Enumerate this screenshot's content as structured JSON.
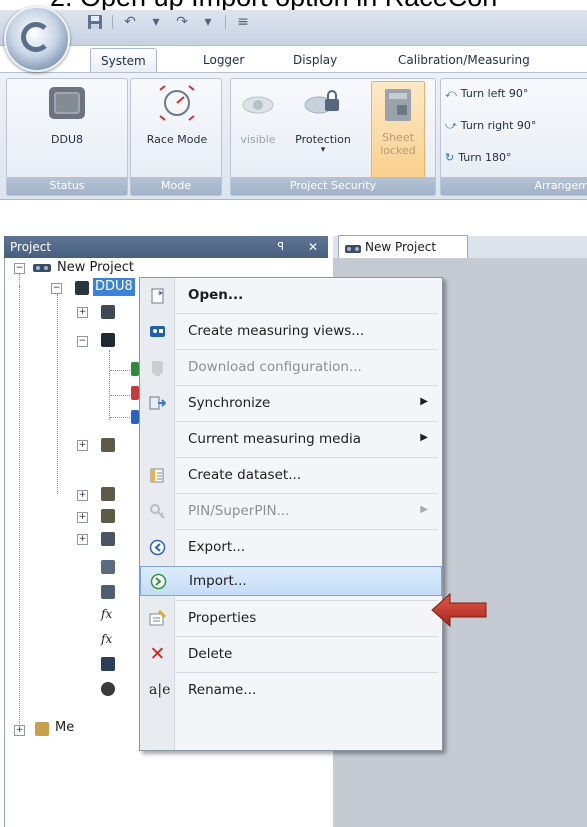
{
  "caption": "2.  Open up Import option in RaceCon",
  "ribbon": {
    "tabs": [
      "System",
      "Logger",
      "Display",
      "Calibration/Measuring"
    ],
    "active_tab": "System",
    "groups": {
      "status": {
        "label": "Status",
        "button": "DDU8"
      },
      "mode": {
        "label": "Mode",
        "button": "Race Mode"
      },
      "project_security": {
        "label": "Project Security",
        "visible": "visible",
        "protection": "Protection",
        "sheet": "Sheet",
        "locked": "locked"
      },
      "arrange": {
        "label": "Arrangem",
        "turn_left": "Turn left 90°",
        "turn_right": "Turn right 90°",
        "turn_180": "Turn 180°"
      }
    }
  },
  "project_pane": {
    "title": "Project",
    "pin": "ꟼ",
    "close": "✕",
    "tree": {
      "root": "New Project",
      "device": "DDU8",
      "other": "Me"
    }
  },
  "document_tab": "New Project",
  "context_menu": {
    "items": [
      {
        "label": "Open...",
        "icon": "open-document-icon"
      },
      {
        "label": "Create measuring views...",
        "icon": "measuring-view-icon"
      },
      {
        "label": "Download configuration...",
        "icon": "download-icon"
      },
      {
        "label": "Synchronize",
        "icon": "synchronize-icon"
      },
      {
        "label": "Current measuring media",
        "icon": ""
      },
      {
        "label": "Create dataset...",
        "icon": "dataset-icon"
      },
      {
        "label": "PIN/SuperPIN...",
        "icon": "key-icon"
      },
      {
        "label": "Export...",
        "icon": "export-icon"
      },
      {
        "label": "Import...",
        "icon": "import-icon"
      },
      {
        "label": "Properties",
        "icon": "properties-icon"
      },
      {
        "label": "Delete",
        "icon": "delete-icon"
      },
      {
        "label": "Rename...",
        "icon": "rename-icon"
      }
    ],
    "highlighted": "Import...",
    "arrow_color": "#c0392b"
  }
}
